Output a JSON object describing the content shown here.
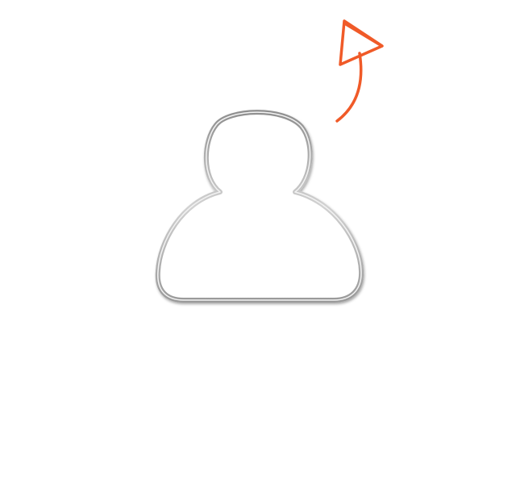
{
  "icons": {
    "avatar": "user-silhouette-icon",
    "arrow": "hand-drawn-arrow-icon"
  },
  "colors": {
    "background": "#ffffff",
    "avatar_outline": "#b9b9b9",
    "avatar_fill": "#ffffff",
    "arrow": "#f05a28"
  }
}
